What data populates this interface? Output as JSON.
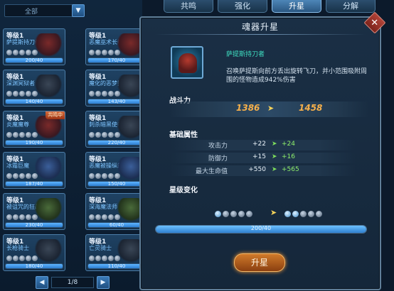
{
  "filter": {
    "value": "全部"
  },
  "tabs": [
    {
      "label": "共鸣"
    },
    {
      "label": "强化"
    },
    {
      "label": "升星"
    },
    {
      "label": "分解"
    }
  ],
  "cards": [
    {
      "level": "等级1",
      "name": "萨提斯持刀者",
      "exp": "200/40",
      "progress": 1.0,
      "art": "red",
      "tag": ""
    },
    {
      "level": "等级1",
      "name": "恶魔巫术长者",
      "exp": "170/40",
      "progress": 1.0,
      "art": "red",
      "tag": ""
    },
    {
      "level": "等级1",
      "name": "深渊冥狱者",
      "exp": "140/40",
      "progress": 1.0,
      "art": "dark",
      "tag": ""
    },
    {
      "level": "等级1",
      "name": "魔化的恶梦执刑者",
      "exp": "143/40",
      "progress": 1.0,
      "art": "dark",
      "tag": ""
    },
    {
      "level": "等级1",
      "name": "炎魔魔尊",
      "exp": "190/40",
      "progress": 1.0,
      "art": "red",
      "tag": "共鸣中"
    },
    {
      "level": "等级1",
      "name": "刺杀暗黑使者",
      "exp": "220/40",
      "progress": 1.0,
      "art": "dark",
      "tag": ""
    },
    {
      "level": "等级1",
      "name": "冰霜巨魔",
      "exp": "187/40",
      "progress": 1.0,
      "art": "blue",
      "tag": ""
    },
    {
      "level": "等级1",
      "name": "恶魔被操纵的魔物",
      "exp": "150/40",
      "progress": 1.0,
      "art": "blue",
      "tag": ""
    },
    {
      "level": "等级1",
      "name": "被诅咒的狂战士",
      "exp": "230/40",
      "progress": 1.0,
      "art": "green",
      "tag": ""
    },
    {
      "level": "等级1",
      "name": "深海魔法师",
      "exp": "60/40",
      "progress": 1.0,
      "art": "green",
      "tag": ""
    },
    {
      "level": "等级1",
      "name": "长枪骑士",
      "exp": "180/40",
      "progress": 1.0,
      "art": "dark",
      "tag": ""
    },
    {
      "level": "等级1",
      "name": "亡灵骑士",
      "exp": "110/40",
      "progress": 1.0,
      "art": "dark",
      "tag": ""
    }
  ],
  "pager": {
    "text": "1/8",
    "prev": "◀",
    "next": "▶"
  },
  "panel": {
    "title": "魂器升星",
    "close": "✕",
    "item_name": "萨提斯持刀者",
    "item_desc": "召唤萨提斯向前方丢出旋转飞刀，并小范围吸附周围的怪物造成942%伤害",
    "power_title": "战斗力",
    "power_old": "1386",
    "power_arrow": "➤",
    "power_new": "1458",
    "attr_title": "基础属性",
    "attrs": [
      {
        "label": "攻击力",
        "cur": "+22",
        "arrow": "➤",
        "new": "+24"
      },
      {
        "label": "防御力",
        "cur": "+15",
        "arrow": "➤",
        "new": "+16"
      },
      {
        "label": "最大生命值",
        "cur": "+550",
        "arrow": "➤",
        "new": "+565"
      }
    ],
    "star_title": "星级变化",
    "star_arrow": "➤",
    "stars_before": 1,
    "stars_after": 2,
    "stars_total": 5,
    "exp_text": "200/40",
    "exp_progress": 1.0,
    "upgrade_label": "升星"
  }
}
